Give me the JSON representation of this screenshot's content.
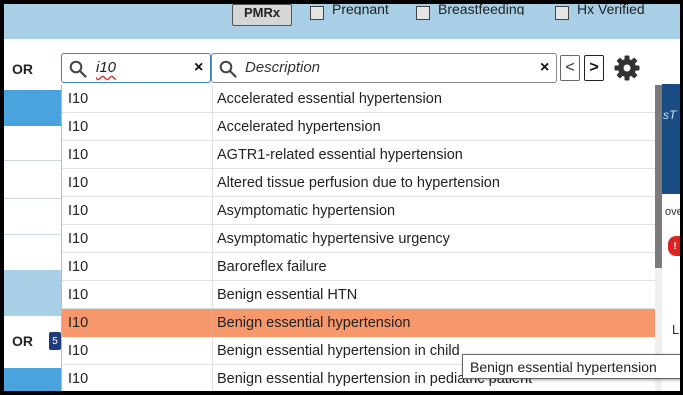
{
  "topbar": {
    "pmrx_label": "PMRx",
    "checkboxes": [
      {
        "label": "Pregnant",
        "checked": false
      },
      {
        "label": "Breastfeeding",
        "checked": false
      },
      {
        "label": "Hx Verified",
        "checked": false
      }
    ]
  },
  "left_labels": [
    "OR",
    "OR"
  ],
  "left_badge": "5",
  "search": {
    "code_value": "i10",
    "code_placeholder": "",
    "desc_value": "",
    "desc_placeholder": "Description",
    "clear_glyph": "×",
    "prev_glyph": "<",
    "next_glyph": ">"
  },
  "results": [
    {
      "code": "I10",
      "description": "Accelerated essential hypertension",
      "selected": false
    },
    {
      "code": "I10",
      "description": "Accelerated hypertension",
      "selected": false
    },
    {
      "code": "I10",
      "description": "AGTR1-related essential hypertension",
      "selected": false
    },
    {
      "code": "I10",
      "description": "Altered tissue perfusion due to hypertension",
      "selected": false
    },
    {
      "code": "I10",
      "description": "Asymptomatic hypertension",
      "selected": false
    },
    {
      "code": "I10",
      "description": "Asymptomatic hypertensive urgency",
      "selected": false
    },
    {
      "code": "I10",
      "description": "Baroreflex failure",
      "selected": false
    },
    {
      "code": "I10",
      "description": "Benign essential HTN",
      "selected": false
    },
    {
      "code": "I10",
      "description": "Benign essential hypertension",
      "selected": true
    },
    {
      "code": "I10",
      "description": "Benign essential hypertension in child",
      "selected": false
    },
    {
      "code": "I10",
      "description": "Benign essential hypertension in pediatric patient",
      "selected": false
    }
  ],
  "tooltip": "Benign essential hypertension",
  "right_strip": {
    "text1": "sT",
    "text2": "ove",
    "badge": "!",
    "text3": "L"
  },
  "colors": {
    "selected_row": "#f6986b",
    "topbar": "#a9cfe6",
    "left_block": "#4aa3dc"
  }
}
